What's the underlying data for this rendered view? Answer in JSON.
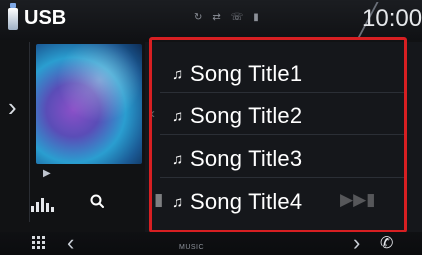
{
  "header": {
    "title": "USB",
    "clock": "10:00",
    "status_icons": [
      "repeat-icon",
      "shuffle-icon",
      "tel-icon",
      "signal-icon"
    ]
  },
  "sidebar": {
    "open_arrow": "›"
  },
  "player": {
    "eq_icon": "equalizer-icon",
    "search_icon": "search-icon"
  },
  "song_list": {
    "items": [
      {
        "title": "Song Title1",
        "icon": "music-note-icon"
      },
      {
        "title": "Song Title2",
        "icon": "music-note-icon"
      },
      {
        "title": "Song Title3",
        "icon": "music-note-icon"
      },
      {
        "title": "Song Title4",
        "icon": "music-note-icon"
      }
    ]
  },
  "bottom_bar": {
    "label": "MUSIC",
    "prev": "‹",
    "next": "›"
  },
  "colors": {
    "highlight": "#d71f22",
    "background": "#111214"
  }
}
